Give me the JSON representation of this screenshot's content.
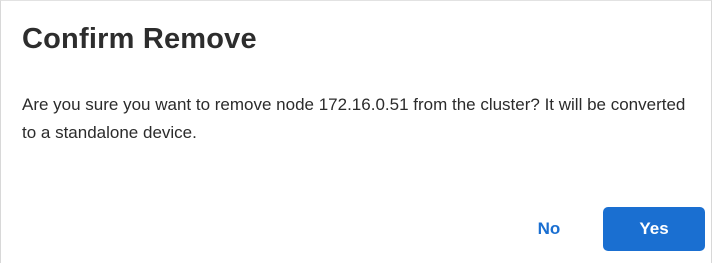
{
  "dialog": {
    "title": "Confirm Remove",
    "message": "Are you sure you want to remove node 172.16.0.51 from the cluster? It will be converted to a standalone device.",
    "buttons": {
      "no_label": "No",
      "yes_label": "Yes"
    }
  },
  "colors": {
    "accent": "#1a6fd1",
    "title_text": "#2d2d2d",
    "body_text": "#2b2b2b"
  }
}
